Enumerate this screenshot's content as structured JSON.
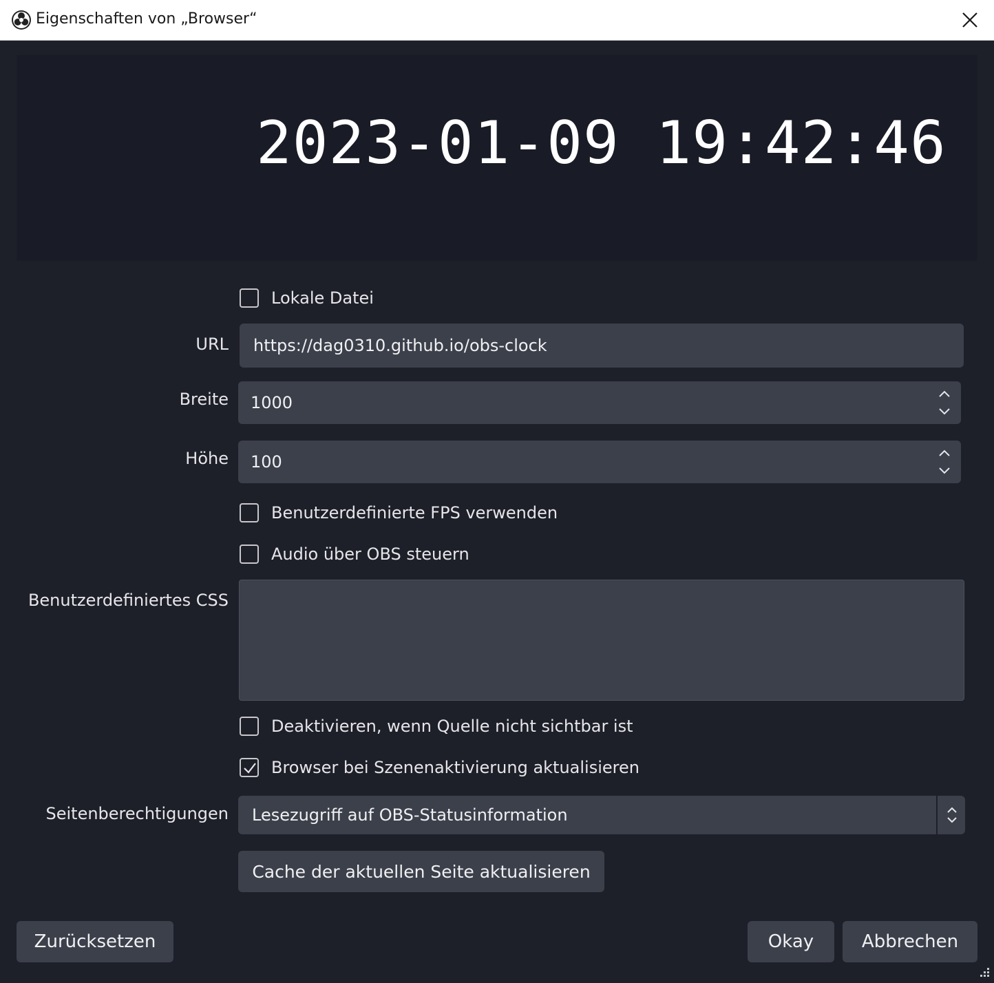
{
  "window": {
    "title": "Eigenschaften von „Browser“",
    "logo_icon": "obs-logo-icon",
    "close_icon": "close-icon"
  },
  "preview": {
    "clock_text": "2023-01-09 19:42:46"
  },
  "form": {
    "local_file": {
      "label": "Lokale Datei",
      "checked": false
    },
    "url": {
      "label": "URL",
      "value": "https://dag0310.github.io/obs-clock"
    },
    "width": {
      "label": "Breite",
      "value": "1000"
    },
    "height": {
      "label": "Höhe",
      "value": "100"
    },
    "custom_fps": {
      "label": "Benutzerdefinierte FPS verwenden",
      "checked": false
    },
    "control_audio": {
      "label": "Audio über OBS steuern",
      "checked": false
    },
    "custom_css": {
      "label": "Benutzerdefiniertes CSS",
      "value": ""
    },
    "shutdown_hidden": {
      "label": "Deaktivieren, wenn Quelle nicht sichtbar ist",
      "checked": false
    },
    "refresh_on_scene": {
      "label": "Browser bei Szenenaktivierung aktualisieren",
      "checked": true
    },
    "page_permissions": {
      "label": "Seitenberechtigungen",
      "value": "Lesezugriff auf OBS-Statusinformation"
    },
    "refresh_cache_button": "Cache der aktuellen Seite aktualisieren"
  },
  "footer": {
    "reset_label": "Zurücksetzen",
    "ok_label": "Okay",
    "cancel_label": "Abbrechen"
  },
  "colors": {
    "background": "#1e2029",
    "preview_bg": "#191b26",
    "field_bg": "#3c404b",
    "text": "#e6e6ea"
  }
}
